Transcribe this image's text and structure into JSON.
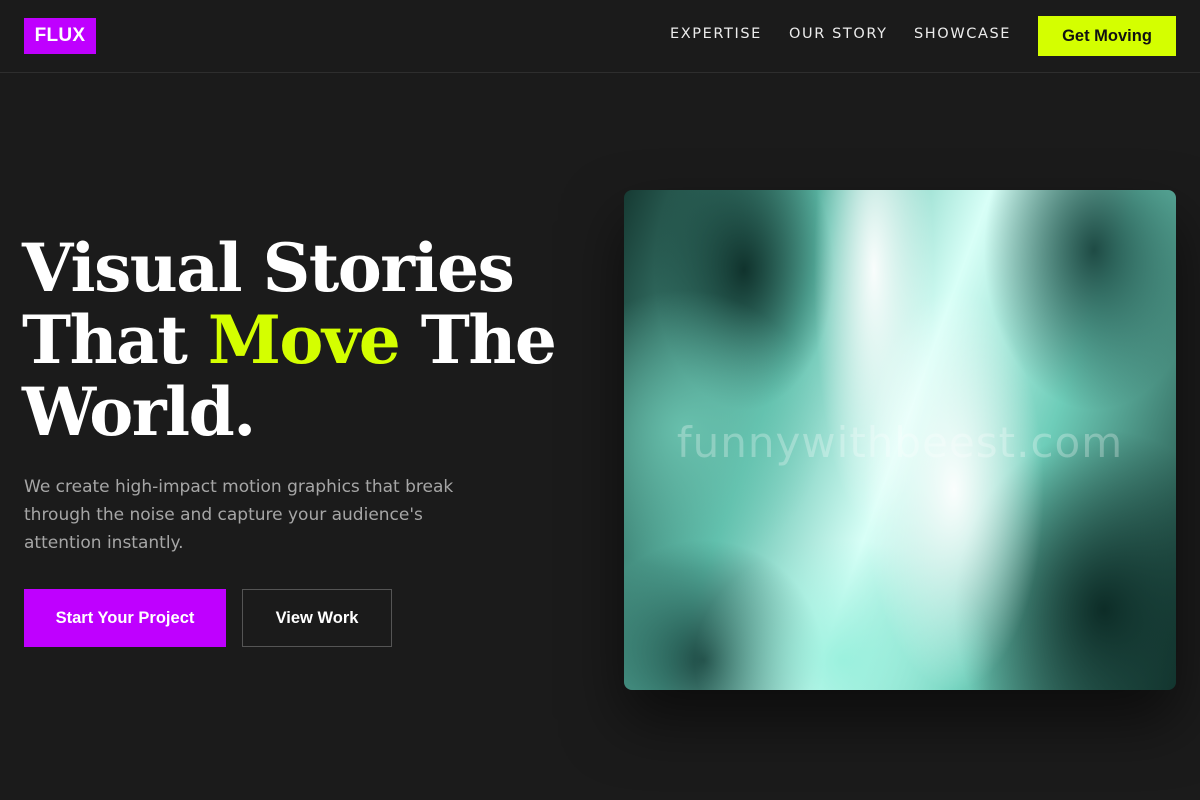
{
  "brand": {
    "logo_text": "FLUX",
    "accent_purple": "#bf00ff",
    "accent_lime": "#d4ff00"
  },
  "nav": {
    "links": [
      "EXPERTISE",
      "OUR STORY",
      "SHOWCASE"
    ],
    "cta_label": "Get Moving"
  },
  "hero": {
    "title_line1": "Visual Stories",
    "title_line2_pre": "That ",
    "title_line2_accent": "Move",
    "title_line2_post": " The",
    "title_line3": "World.",
    "subtitle": "We create high-impact motion graphics that break through the noise and capture your audience's attention instantly.",
    "primary_button": "Start Your Project",
    "secondary_button": "View Work"
  },
  "media": {
    "watermark_text": "funnywithbeest.com"
  }
}
